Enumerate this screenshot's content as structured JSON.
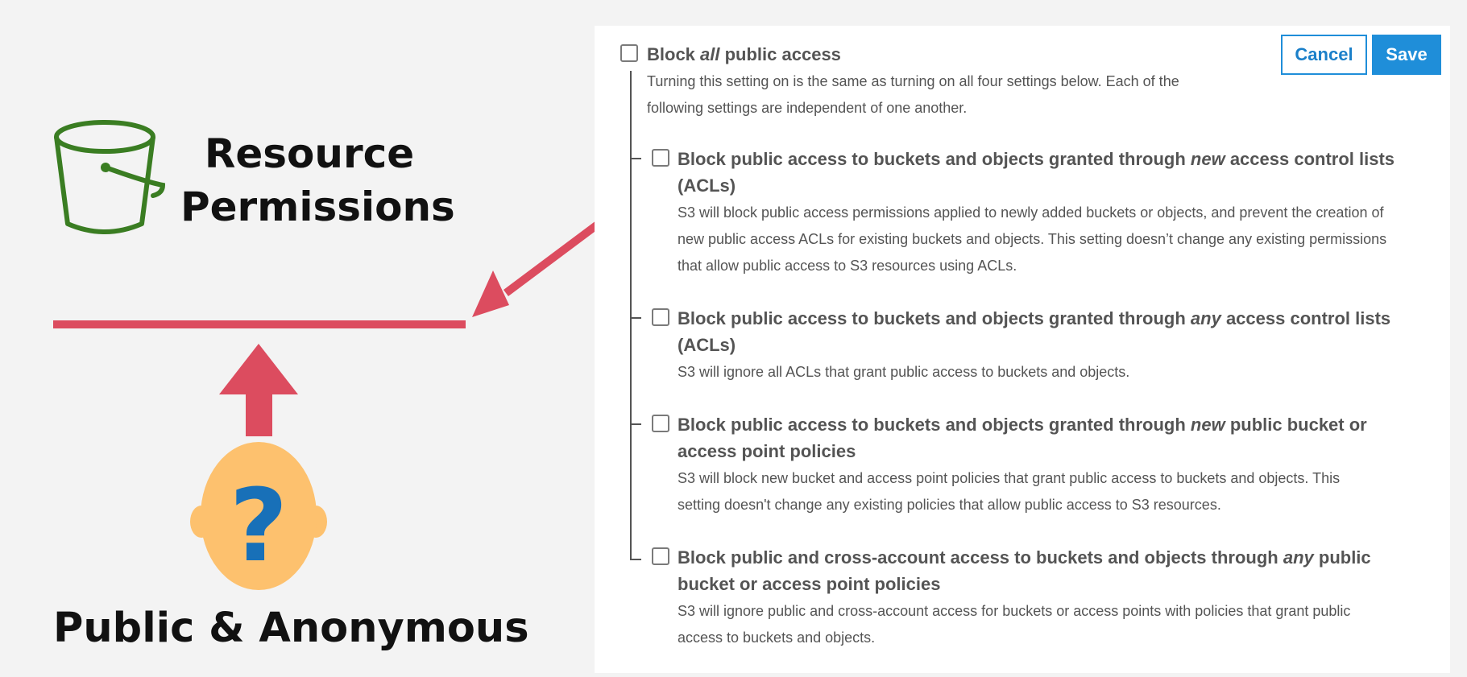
{
  "illustration": {
    "resource_title_line1": "Resource",
    "resource_title_line2": "Permissions",
    "public_title": "Public & Anonymous",
    "head_symbol": "?",
    "icons": [
      "bucket-icon",
      "arrow-icon",
      "barrier-line",
      "up-arrow-icon",
      "anonymous-head-icon"
    ],
    "colors": {
      "bucket": "#3a7d22",
      "arrow": "#dc4c5f",
      "head": "#fdc16e",
      "question": "#1870b8"
    }
  },
  "settings": {
    "buttons": {
      "cancel": "Cancel",
      "save": "Save"
    },
    "master": {
      "label_pre": "Block ",
      "label_em": "all",
      "label_post": " public access",
      "description_line1": "Turning this setting on is the same as turning on all four settings below. Each of the",
      "description_line2": "following settings are independent of one another.",
      "checked": false
    },
    "options": [
      {
        "line1_pre": "Block public access to buckets and objects granted through ",
        "line1_em": "new",
        "line1_post": " access control lists",
        "line2": "(ACLs)",
        "desc": [
          "S3 will block public access permissions applied to newly added buckets or objects, and prevent the creation of",
          "new public access ACLs for existing buckets and objects. This setting doesn’t change any existing permissions",
          "that allow public access to S3 resources using ACLs."
        ],
        "checked": false
      },
      {
        "line1_pre": "Block public access to buckets and objects granted through ",
        "line1_em": "any",
        "line1_post": " access control lists",
        "line2": "(ACLs)",
        "desc": [
          "S3 will ignore all ACLs that grant public access to buckets and objects."
        ],
        "checked": false
      },
      {
        "line1_pre": "Block public access to buckets and objects granted through ",
        "line1_em": "new",
        "line1_post": " public bucket or",
        "line2": "access point policies",
        "desc": [
          "S3 will block new bucket and access point policies that grant public access to buckets and objects. This",
          "setting doesn't change any existing policies that allow public access to S3 resources."
        ],
        "checked": false
      },
      {
        "line1_pre": "Block public and cross-account access to buckets and objects through ",
        "line1_em": "any",
        "line1_post": " public",
        "line2": "bucket or access point policies",
        "desc": [
          "S3 will ignore public and cross-account access for buckets or access points with policies that grant public",
          "access to buckets and objects."
        ],
        "checked": false
      }
    ]
  }
}
